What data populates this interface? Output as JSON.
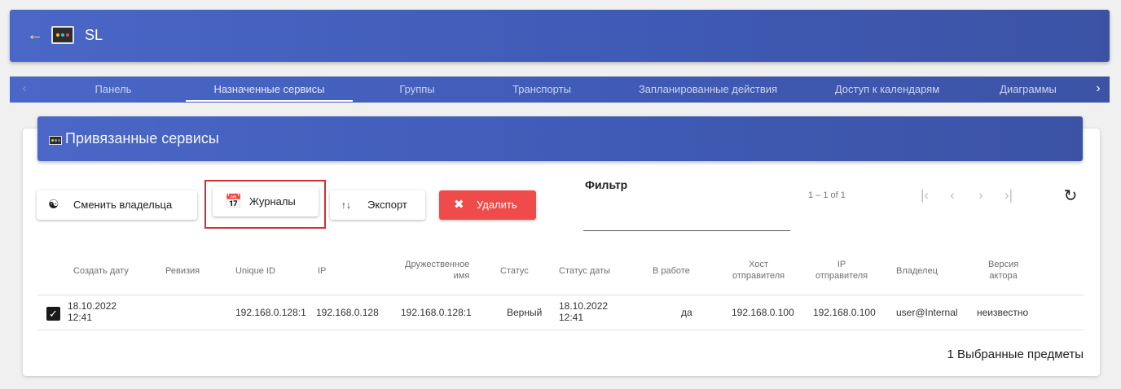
{
  "app": {
    "title": "SL",
    "back_icon": "arrow-left-icon",
    "icon_colors": [
      "#f5c518",
      "#36c3f0",
      "#e05050"
    ]
  },
  "tabs": [
    {
      "label": "Панель",
      "active": false
    },
    {
      "label": "Назначенные сервисы",
      "active": true
    },
    {
      "label": "Группы",
      "active": false
    },
    {
      "label": "Транспорты",
      "active": false
    },
    {
      "label": "Запланированные действия",
      "active": false
    },
    {
      "label": "Доступ к календарям",
      "active": false
    },
    {
      "label": "Диаграммы",
      "active": false
    }
  ],
  "card": {
    "title": "Привязанные сервисы"
  },
  "toolbar": {
    "change_owner": "Сменить владельца",
    "logs": "Журналы",
    "export": "Экспорт",
    "delete": "Удалить",
    "delete_color": "#ef4b4b",
    "highlight_color": "#d32f2f"
  },
  "filter": {
    "label": "Фильтр",
    "value": ""
  },
  "paginator": {
    "range": "1 – 1 of 1"
  },
  "table": {
    "headers": {
      "created": "Создать дату",
      "revision": "Ревизия",
      "unique_id": "Unique ID",
      "ip": "IP",
      "friendly_name_1": "Дружественное",
      "friendly_name_2": "имя",
      "status": "Статус",
      "status_date": "Статус даты",
      "in_use": "В работе",
      "src_host_1": "Хост",
      "src_host_2": "отправителя",
      "src_ip_1": "IP",
      "src_ip_2": "отправителя",
      "owner": "Владелец",
      "actor_version_1": "Версия",
      "actor_version_2": "актора"
    },
    "rows": [
      {
        "selected": true,
        "created_date": "18.10.2022",
        "created_time": "12:41",
        "revision": "",
        "unique_id": "192.168.0.128:1",
        "ip": "192.168.0.128",
        "friendly_name": "192.168.0.128:1",
        "status": "Верный",
        "status_date": "18.10.2022",
        "status_time": "12:41",
        "in_use": "да",
        "src_host": "192.168.0.100",
        "src_ip": "192.168.0.100",
        "owner": "user@Internal",
        "actor_version": "неизвестно"
      }
    ]
  },
  "footer": {
    "selected_text": "1 Выбранные предметы"
  }
}
